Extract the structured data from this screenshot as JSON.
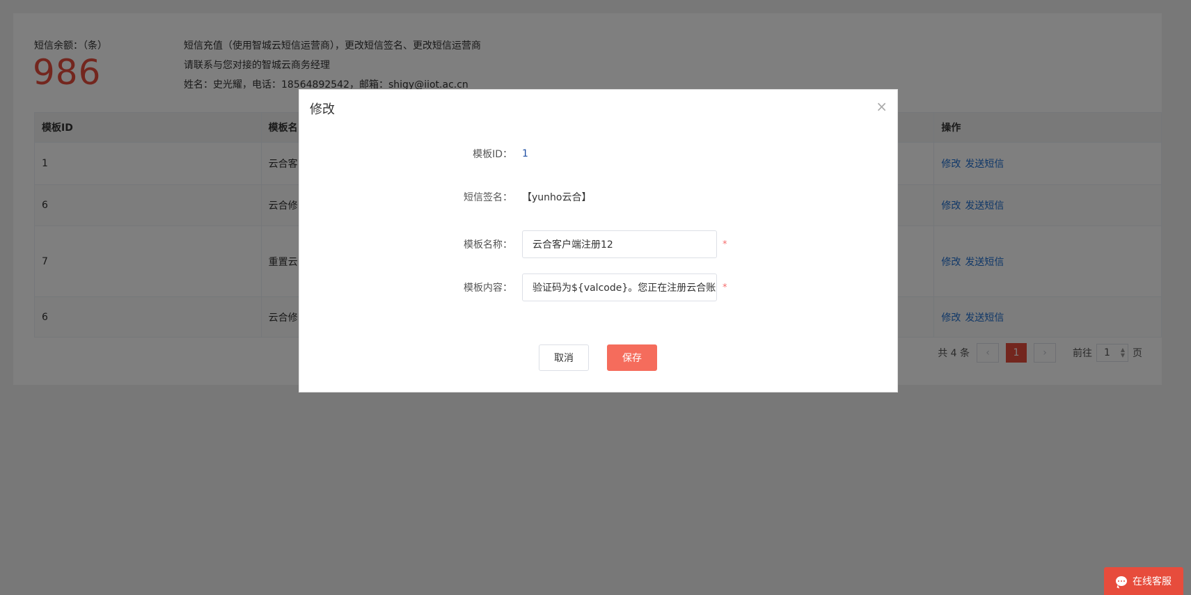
{
  "balance": {
    "label": "短信余额：（条）",
    "value": "986"
  },
  "info": {
    "line1": "短信充值（使用智城云短信运营商），更改短信签名、更改短信运营商",
    "line2": "请联系与您对接的智城云商务经理",
    "line3": "姓名：史光耀，电话：18564892542，邮箱：shigy@iiot.ac.cn"
  },
  "table": {
    "headers": [
      "模板ID",
      "模板名",
      "操作"
    ],
    "rows": [
      {
        "id": "1",
        "name": "云合客",
        "edit": "修改",
        "send": "发送短信"
      },
      {
        "id": "6",
        "name": "云合修",
        "edit": "修改",
        "send": "发送短信"
      },
      {
        "id": "7",
        "name": "重置云",
        "edit": "修改",
        "send": "发送短信"
      },
      {
        "id": "6",
        "name": "云合修",
        "edit": "修改",
        "send": "发送短信"
      }
    ]
  },
  "pager": {
    "total": "共 4 条",
    "current": "1",
    "goto_label": "前往",
    "goto_value": "1",
    "page_suffix": "页"
  },
  "dialog": {
    "title": "修改",
    "close": "×",
    "fields": {
      "template_id_label": "模板ID：",
      "template_id_value": "1",
      "signature_label": "短信签名：",
      "signature_value": "【yunho云合】",
      "name_label": "模板名称：",
      "name_value": "云合客户端注册12",
      "content_label": "模板内容：",
      "content_value": "验证码为${valcode}。您正在注册云合账",
      "required_mark": "*"
    },
    "cancel_label": "取消",
    "save_label": "保存"
  },
  "service": {
    "label": "在线客服"
  },
  "colors": {
    "accent": "#e74c3c",
    "link": "#1f6fd1"
  }
}
